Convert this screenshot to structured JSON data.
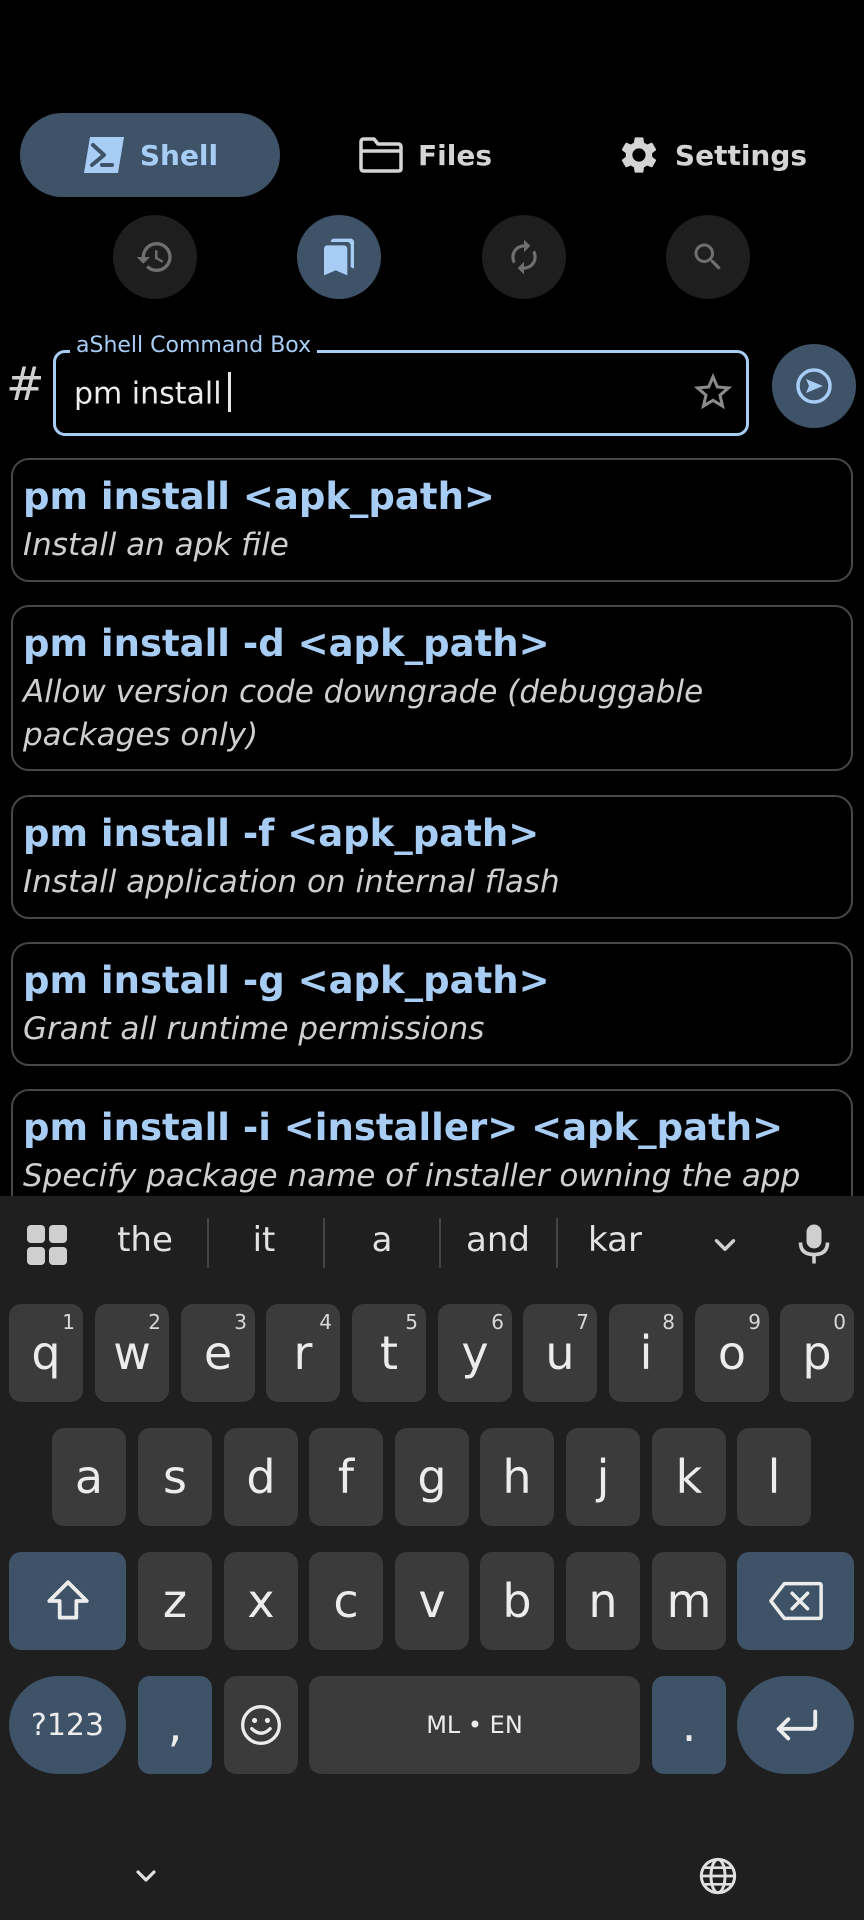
{
  "nav": {
    "shell": "Shell",
    "files": "Files",
    "settings": "Settings"
  },
  "tools": [
    "history-icon",
    "bookmarks-icon",
    "refresh-icon",
    "search-icon"
  ],
  "command": {
    "hash": "#",
    "label": "aShell Command Box",
    "value": "pm install"
  },
  "suggestions": [
    {
      "title": "pm install <apk_path>",
      "desc": "Install an apk file"
    },
    {
      "title": "pm install -d <apk_path>",
      "desc": "Allow version code downgrade (debuggable packages only)"
    },
    {
      "title": "pm install -f <apk_path>",
      "desc": "Install application on internal flash"
    },
    {
      "title": "pm install -g <apk_path>",
      "desc": "Grant all runtime permissions"
    },
    {
      "title": "pm install -i <installer> <apk_path>",
      "desc": "Specify package name of installer owning the app"
    }
  ],
  "keyboard": {
    "word_suggestions": [
      "the",
      "it",
      "a",
      "and",
      "kar"
    ],
    "row1": [
      {
        "k": "q",
        "h": "1"
      },
      {
        "k": "w",
        "h": "2"
      },
      {
        "k": "e",
        "h": "3"
      },
      {
        "k": "r",
        "h": "4"
      },
      {
        "k": "t",
        "h": "5"
      },
      {
        "k": "y",
        "h": "6"
      },
      {
        "k": "u",
        "h": "7"
      },
      {
        "k": "i",
        "h": "8"
      },
      {
        "k": "o",
        "h": "9"
      },
      {
        "k": "p",
        "h": "0"
      }
    ],
    "row2": [
      "a",
      "s",
      "d",
      "f",
      "g",
      "h",
      "j",
      "k",
      "l"
    ],
    "row3": [
      "z",
      "x",
      "c",
      "v",
      "b",
      "n",
      "m"
    ],
    "symbols_label": "?123",
    "comma_label": ",",
    "space_label": "ML • EN",
    "period_label": "."
  },
  "colors": {
    "accent": "#a8cdf5",
    "active_bg": "#3e5268",
    "key_bg": "#3b3b3b",
    "keyboard_bg": "#1f1f1f"
  }
}
